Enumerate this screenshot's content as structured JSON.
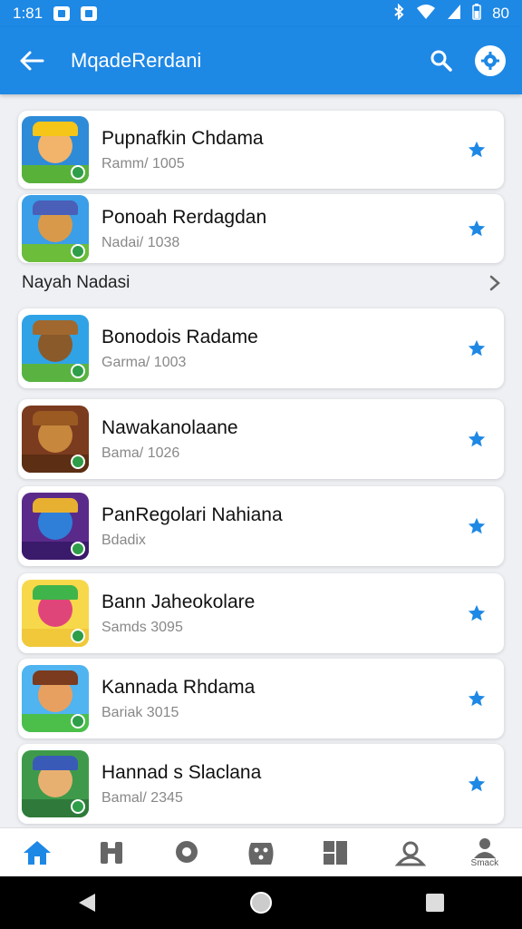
{
  "status_bar": {
    "time": "1:81",
    "battery": "80"
  },
  "app_bar": {
    "title": "MqadeRerdani"
  },
  "section": {
    "label": "Nayah Nadasi"
  },
  "top_items": [
    {
      "title": "Pupnafkin Chdama",
      "subtitle": "Ramm/ 1005",
      "thumb_bg": "#2e8bd8",
      "face": "#f2b36b",
      "hat": "#f5c518",
      "ground": "#58b23a"
    },
    {
      "title": "Ponoah Rerdagdan",
      "subtitle": "Nadai/ 1038",
      "thumb_bg": "#3a9ee8",
      "face": "#d89a4a",
      "hat": "#4a5fb8",
      "ground": "#6bbd3a"
    }
  ],
  "items": [
    {
      "title": "Bonodois Radame",
      "subtitle": "Garma/ 1003",
      "thumb_bg": "#2fa3e6",
      "face": "#8a5a2b",
      "hat": "#a0682f",
      "ground": "#5ab340"
    },
    {
      "title": "Nawakanolaane",
      "subtitle": "Bama/ 1026",
      "thumb_bg": "#7a3b1f",
      "face": "#c7873c",
      "hat": "#9a5a22",
      "ground": "#5c2e14"
    },
    {
      "title": "PanRegolari Nahiana",
      "subtitle": "Bdadix",
      "thumb_bg": "#5a2a8a",
      "face": "#2f7fd8",
      "hat": "#e8b030",
      "ground": "#3a1a6a"
    },
    {
      "title": "Bann Jaheokolare",
      "subtitle": "Samds 3095",
      "thumb_bg": "#f7d84a",
      "face": "#e0457a",
      "hat": "#3fb44a",
      "ground": "#f0c83a"
    },
    {
      "title": "Kannada Rhdama",
      "subtitle": "Bariak 3015",
      "thumb_bg": "#4fb4f0",
      "face": "#e8a060",
      "hat": "#7a3b1f",
      "ground": "#4bbf4a"
    },
    {
      "title": "Hannad s Slaclana",
      "subtitle": "Bamal/ 2345",
      "thumb_bg": "#3e9a4a",
      "face": "#e8b070",
      "hat": "#3a5ab8",
      "ground": "#2f7a3a"
    }
  ],
  "bottom_nav": [
    {
      "name": "home",
      "label": ""
    },
    {
      "name": "tools",
      "label": ""
    },
    {
      "name": "location",
      "label": ""
    },
    {
      "name": "games",
      "label": ""
    },
    {
      "name": "grid",
      "label": ""
    },
    {
      "name": "account",
      "label": ""
    },
    {
      "name": "profile",
      "label": "Smack"
    }
  ],
  "colors": {
    "accent": "#1e88e5",
    "star": "#1e88e5",
    "nav_active": "#1e88e5",
    "nav_inactive": "#666666"
  }
}
